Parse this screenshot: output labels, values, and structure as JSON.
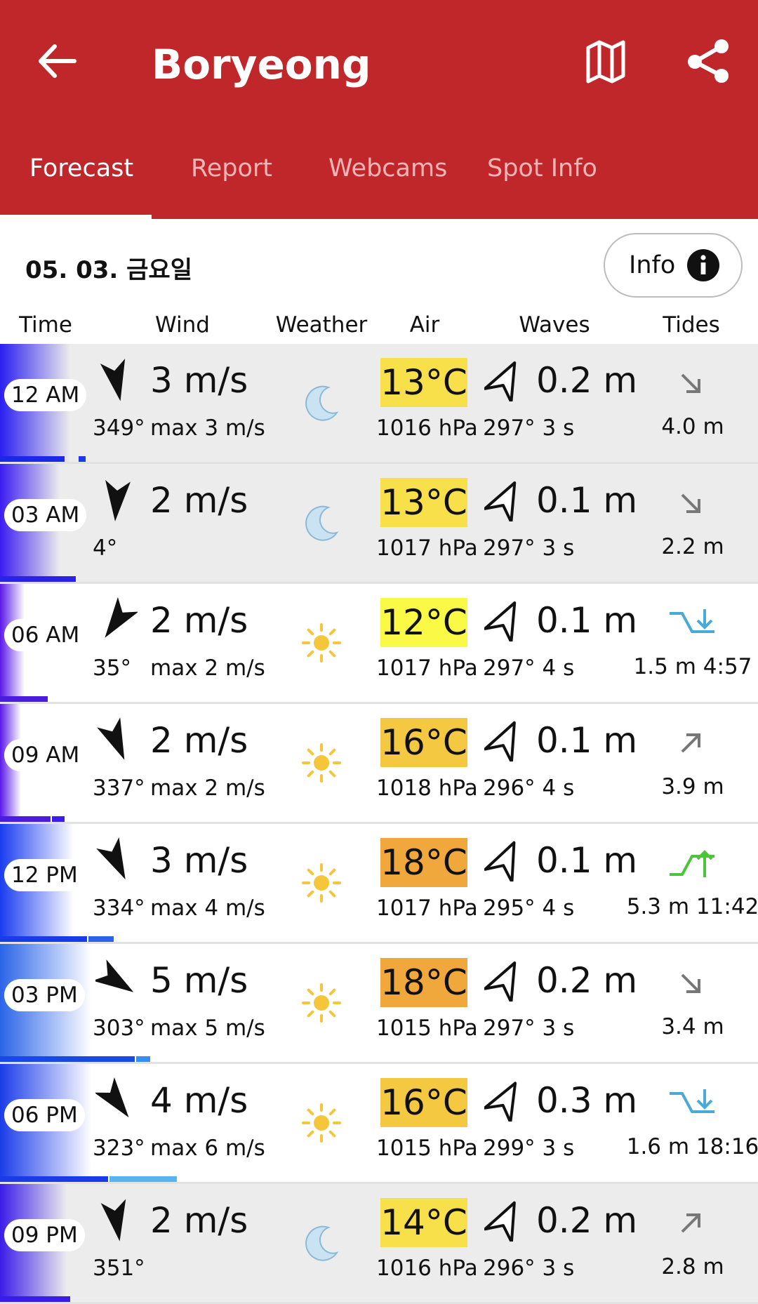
{
  "header": {
    "title": "Boryeong",
    "bg_color": "#c0272b",
    "tabs": [
      {
        "label": "Forecast",
        "active": true
      },
      {
        "label": "Report",
        "active": false
      },
      {
        "label": "Webcams",
        "active": false
      },
      {
        "label": "Spot Info",
        "active": false
      }
    ]
  },
  "date_label": "05. 03. 금요일",
  "info_button": "Info",
  "columns": [
    "Time",
    "Wind",
    "Weather",
    "Air",
    "Waves",
    "Tides"
  ],
  "rows": [
    {
      "time": "12 AM",
      "speed": "3 m/s",
      "dir": "349°",
      "gust": "max 3 m/s",
      "weather": "moon-icon",
      "temp": "13°C",
      "temp_color": "#f7e04a",
      "pressure": "1016 hPa",
      "wave_height": "0.2 m",
      "wave_info": "297° 3 s",
      "tide_icon": "arrow-down-right-icon",
      "tide_text": "4.0 m",
      "wind_deg": 349,
      "wave_deg": 297
    },
    {
      "time": "03 AM",
      "speed": "2 m/s",
      "dir": "4°",
      "gust": "",
      "weather": "moon-icon",
      "temp": "13°C",
      "temp_color": "#f7e04a",
      "pressure": "1017 hPa",
      "wave_height": "0.1 m",
      "wave_info": "297° 3 s",
      "tide_icon": "arrow-down-right-icon",
      "tide_text": "2.2 m",
      "wind_deg": 4,
      "wave_deg": 297
    },
    {
      "time": "06 AM",
      "speed": "2 m/s",
      "dir": "35°",
      "gust": "max 2 m/s",
      "weather": "sun-icon",
      "temp": "12°C",
      "temp_color": "#fafa46",
      "pressure": "1017 hPa",
      "wave_height": "0.1 m",
      "wave_info": "297° 4 s",
      "tide_icon": "low-tide-icon",
      "tide_text": "1.5 m 4:57",
      "wind_deg": 35,
      "wave_deg": 297
    },
    {
      "time": "09 AM",
      "speed": "2 m/s",
      "dir": "337°",
      "gust": "max 2 m/s",
      "weather": "sun-icon",
      "temp": "16°C",
      "temp_color": "#f5c842",
      "pressure": "1018 hPa",
      "wave_height": "0.1 m",
      "wave_info": "296° 4 s",
      "tide_icon": "arrow-up-right-icon",
      "tide_text": "3.9 m",
      "wind_deg": 337,
      "wave_deg": 296
    },
    {
      "time": "12 PM",
      "speed": "3 m/s",
      "dir": "334°",
      "gust": "max 4 m/s",
      "weather": "sun-icon",
      "temp": "18°C",
      "temp_color": "#f0a83c",
      "pressure": "1017 hPa",
      "wave_height": "0.1 m",
      "wave_info": "295° 4 s",
      "tide_icon": "high-tide-icon",
      "tide_text": "5.3 m 11:42",
      "wind_deg": 334,
      "wave_deg": 295
    },
    {
      "time": "03 PM",
      "speed": "5 m/s",
      "dir": "303°",
      "gust": "max 5 m/s",
      "weather": "sun-icon",
      "temp": "18°C",
      "temp_color": "#f0a83c",
      "pressure": "1015 hPa",
      "wave_height": "0.2 m",
      "wave_info": "297° 3 s",
      "tide_icon": "arrow-down-right-icon",
      "tide_text": "3.4 m",
      "wind_deg": 303,
      "wave_deg": 297
    },
    {
      "time": "06 PM",
      "speed": "4 m/s",
      "dir": "323°",
      "gust": "max 6 m/s",
      "weather": "sun-icon",
      "temp": "16°C",
      "temp_color": "#f5c842",
      "pressure": "1015 hPa",
      "wave_height": "0.3 m",
      "wave_info": "299° 3 s",
      "tide_icon": "low-tide-icon",
      "tide_text": "1.6 m 18:16",
      "wind_deg": 323,
      "wave_deg": 299
    },
    {
      "time": "09 PM",
      "speed": "2 m/s",
      "dir": "351°",
      "gust": "",
      "weather": "moon-icon",
      "temp": "14°C",
      "temp_color": "#f7e04a",
      "pressure": "1016 hPa",
      "wave_height": "0.2 m",
      "wave_info": "296° 3 s",
      "tide_icon": "arrow-up-right-icon",
      "tide_text": "2.8 m",
      "wind_deg": 351,
      "wave_deg": 296
    }
  ]
}
